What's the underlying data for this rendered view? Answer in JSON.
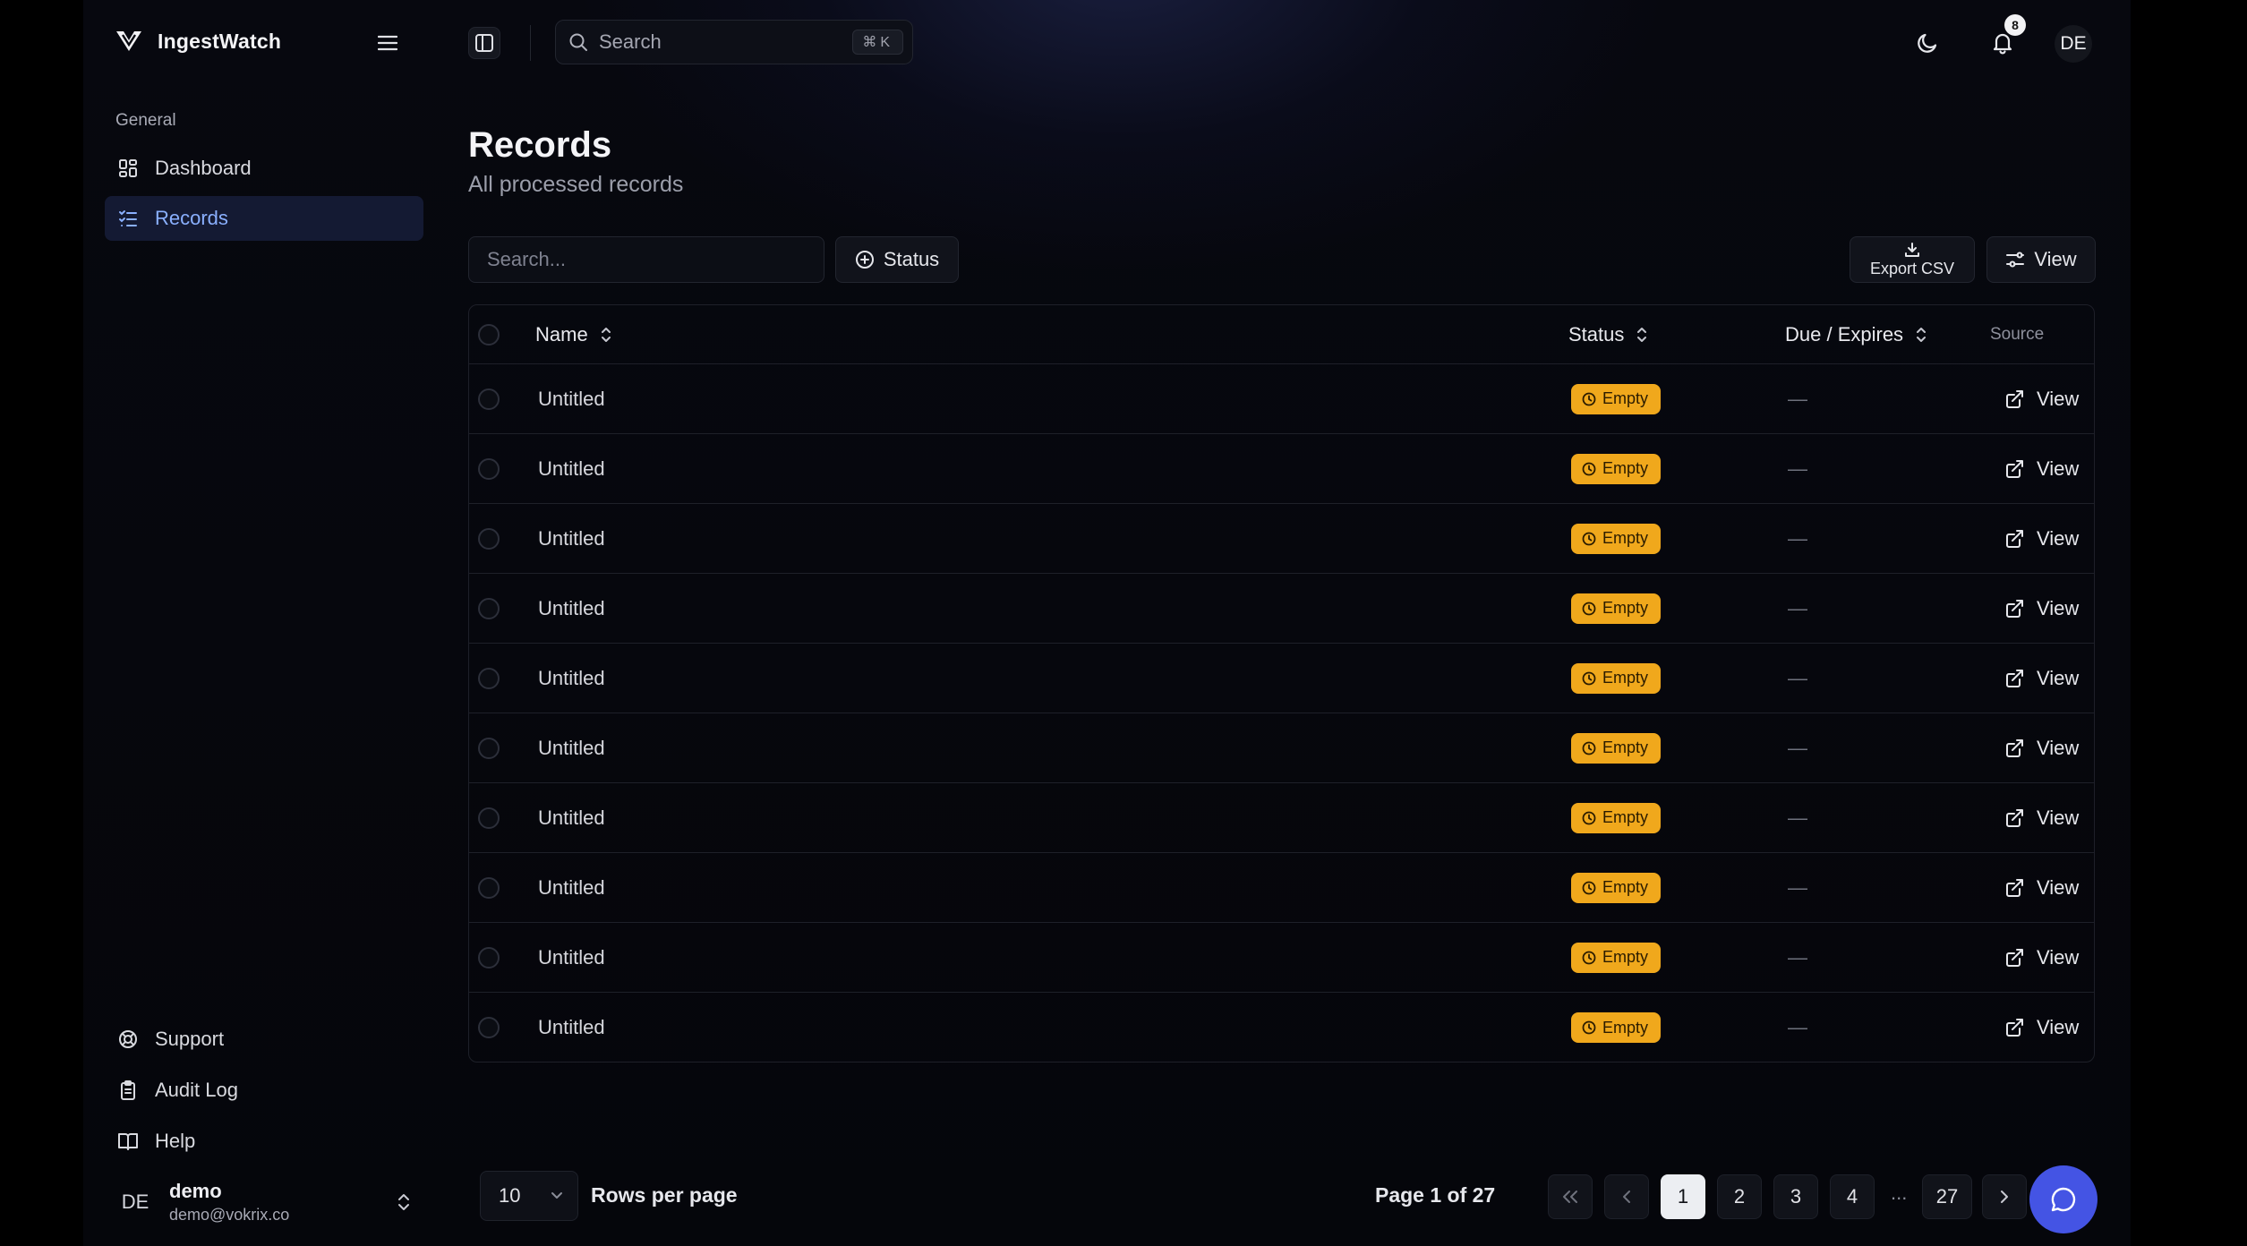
{
  "app": {
    "name": "IngestWatch"
  },
  "sidebar": {
    "group_label": "General",
    "items": [
      {
        "label": "Dashboard",
        "icon": "dashboard-icon"
      },
      {
        "label": "Records",
        "icon": "records-list-icon",
        "active": true
      }
    ],
    "bottom_items": [
      {
        "label": "Support",
        "icon": "lifebuoy-icon"
      },
      {
        "label": "Audit Log",
        "icon": "clipboard-icon"
      },
      {
        "label": "Help",
        "icon": "book-icon"
      }
    ],
    "user": {
      "initials": "DE",
      "name": "demo",
      "email": "demo@vokrix.co"
    }
  },
  "topbar": {
    "search_label": "Search",
    "shortcut": "⌘K",
    "notifications_count": "8",
    "avatar_initials": "DE"
  },
  "page": {
    "title": "Records",
    "subtitle": "All processed records"
  },
  "toolbar": {
    "search_placeholder": "Search...",
    "status_filter_label": "Status",
    "export_label": "Export CSV",
    "view_label": "View"
  },
  "table": {
    "columns": {
      "name": "Name",
      "status": "Status",
      "due": "Due / Expires",
      "source": "Source"
    },
    "rows": [
      {
        "name": "Untitled",
        "status": "Empty",
        "due": "—",
        "source": "View"
      },
      {
        "name": "Untitled",
        "status": "Empty",
        "due": "—",
        "source": "View"
      },
      {
        "name": "Untitled",
        "status": "Empty",
        "due": "—",
        "source": "View"
      },
      {
        "name": "Untitled",
        "status": "Empty",
        "due": "—",
        "source": "View"
      },
      {
        "name": "Untitled",
        "status": "Empty",
        "due": "—",
        "source": "View"
      },
      {
        "name": "Untitled",
        "status": "Empty",
        "due": "—",
        "source": "View"
      },
      {
        "name": "Untitled",
        "status": "Empty",
        "due": "—",
        "source": "View"
      },
      {
        "name": "Untitled",
        "status": "Empty",
        "due": "—",
        "source": "View"
      },
      {
        "name": "Untitled",
        "status": "Empty",
        "due": "—",
        "source": "View"
      },
      {
        "name": "Untitled",
        "status": "Empty",
        "due": "—",
        "source": "View"
      }
    ]
  },
  "pagination": {
    "rows_per_page_value": "10",
    "rows_per_page_label": "Rows per page",
    "page_info": "Page 1 of 27",
    "pages": [
      "1",
      "2",
      "3",
      "4"
    ],
    "ellipsis": "...",
    "last_page": "27",
    "current_page": "1"
  },
  "colors": {
    "background": "#05060b",
    "accent": "#8ab0ff",
    "active_nav_bg": "#141a33",
    "status_empty": "#f0a81c",
    "chat_button": "#4454e4"
  }
}
